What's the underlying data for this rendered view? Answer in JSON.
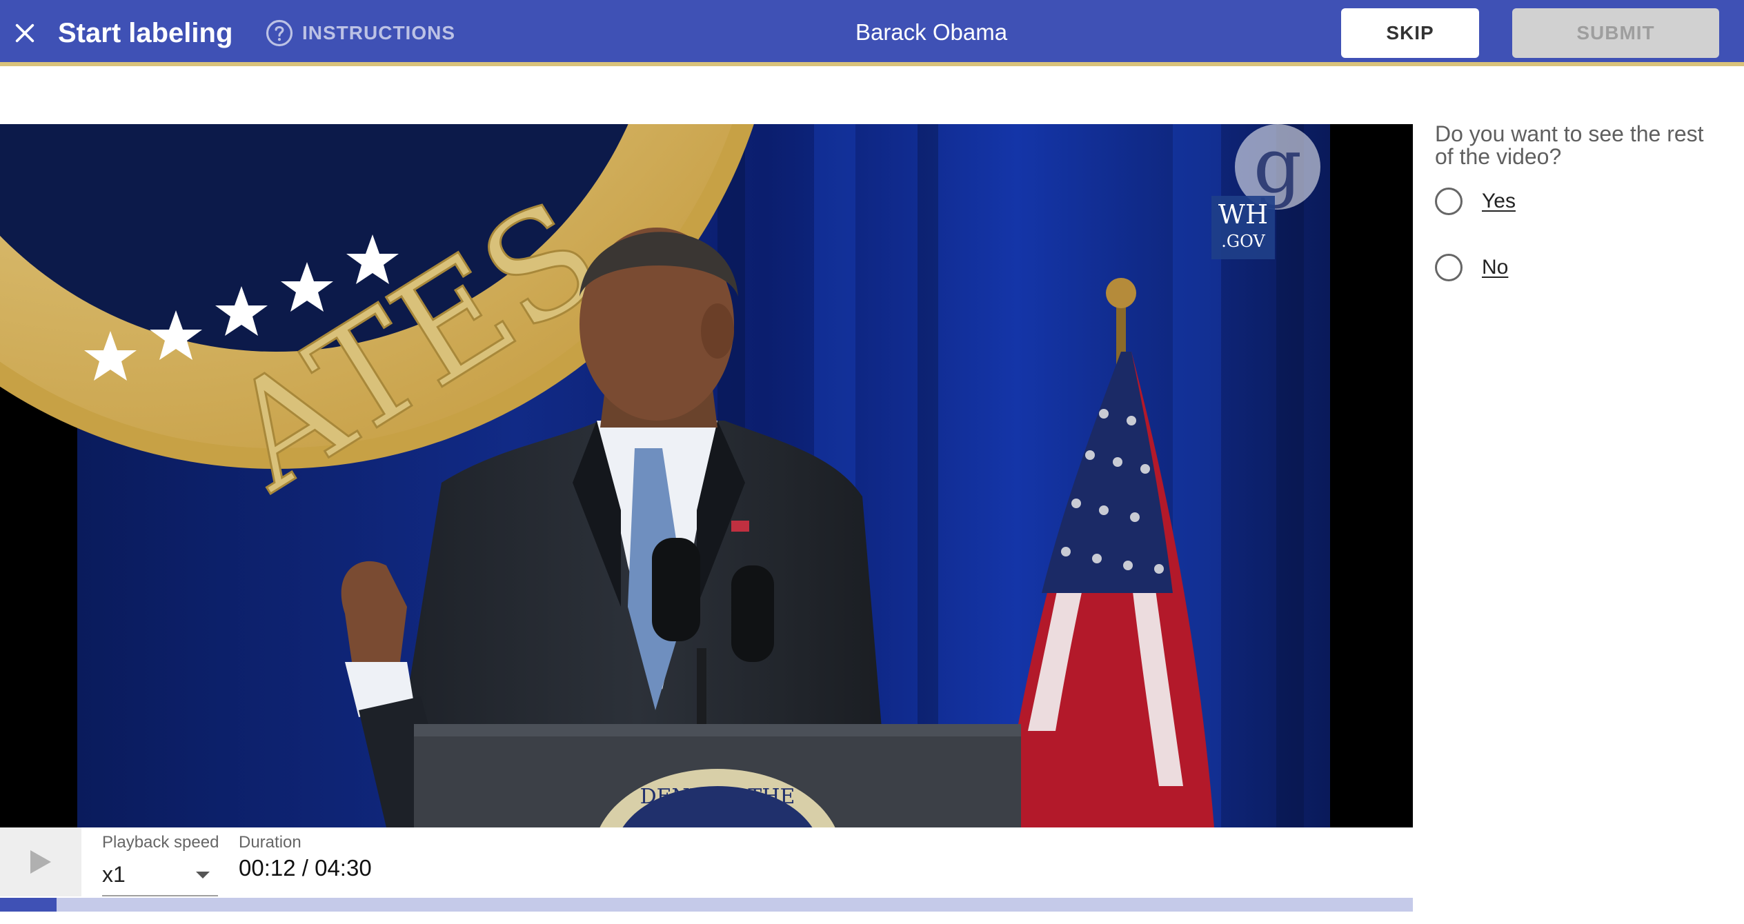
{
  "header": {
    "title": "Start labeling",
    "instructions_label": "INSTRUCTIONS",
    "task_title": "Barack Obama",
    "skip_label": "SKIP",
    "submit_label": "SUBMIT",
    "icons": {
      "close": "close-icon",
      "instructions": "help-circle-icon"
    },
    "colors": {
      "bar": "#3f51b5",
      "accent_line": "#d9c27a"
    }
  },
  "video": {
    "watermark_line1": "WH",
    "watermark_line2": ".GOV",
    "watermark_logo": "g",
    "seal_text": "ATES",
    "podium_text": "DENT OF THE"
  },
  "controls": {
    "playback_speed_label": "Playback speed",
    "playback_speed_value": "x1",
    "duration_label": "Duration",
    "duration_value": "00:12 / 04:30",
    "progress_fraction": 0.04,
    "icons": {
      "play": "play-icon",
      "dropdown": "chevron-down-icon"
    }
  },
  "question": {
    "text": "Do you want to see the rest of the video?",
    "options": [
      {
        "label": "Yes",
        "selected": false
      },
      {
        "label": "No",
        "selected": false
      }
    ]
  }
}
